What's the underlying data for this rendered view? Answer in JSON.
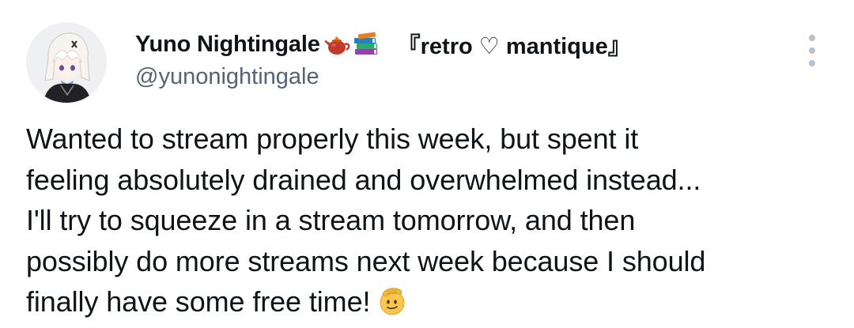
{
  "author": {
    "display_name": "Yuno Nightingale",
    "name_emojis": [
      "teapot-emoji",
      "books-emoji"
    ],
    "name_tag": "『retro ♡ mantique』",
    "handle": "@yunonightingale",
    "avatar_icon": "avatar"
  },
  "menu": {
    "icon": "more-vertical-icon"
  },
  "tweet": {
    "lines": [
      "Wanted to stream properly this week, but spent it",
      "feeling absolutely drained and overwhelmed instead...",
      "I'll try to squeeze in a stream tomorrow, and then",
      "possibly do more streams next week because I should",
      "finally have some free time!"
    ],
    "trailing_emoji": "saluting-face-emoji"
  },
  "colors": {
    "text_primary": "#0f1419",
    "text_secondary": "#536471",
    "menu_dots": "#b9c1c8",
    "background": "#ffffff"
  }
}
